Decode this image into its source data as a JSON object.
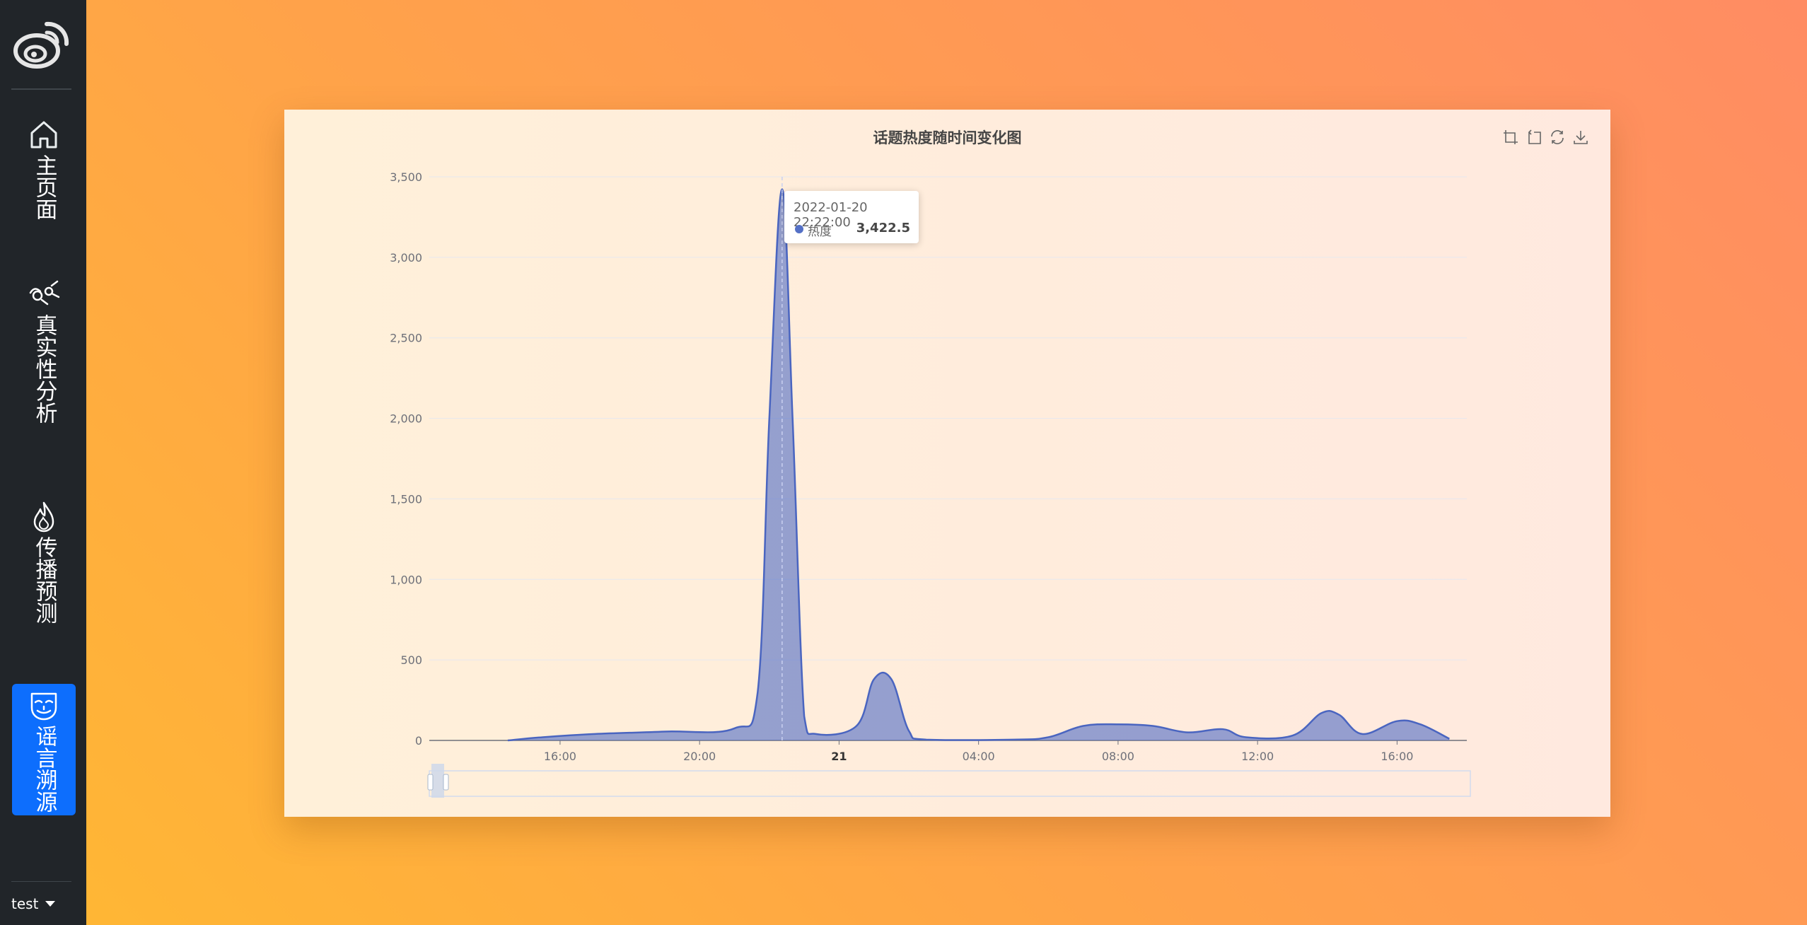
{
  "sidebar": {
    "items": [
      {
        "label": "主页面",
        "icon": "home-icon",
        "active": false
      },
      {
        "label": "真实性分析",
        "icon": "analysis-icon",
        "active": false
      },
      {
        "label": "传播预测",
        "icon": "flame-icon",
        "active": false
      },
      {
        "label": "谣言溯源",
        "icon": "mask-icon",
        "active": true
      }
    ],
    "user": "test"
  },
  "chart_data": {
    "type": "area",
    "title": "话题热度随时间变化图",
    "series": [
      {
        "name": "热度",
        "color": "#5470c6",
        "points": [
          [
            "2022-01-20 14:30",
            0
          ],
          [
            "2022-01-20 15:30",
            20
          ],
          [
            "2022-01-20 17:00",
            40
          ],
          [
            "2022-01-20 19:00",
            55
          ],
          [
            "2022-01-20 21:00",
            75
          ],
          [
            "2022-01-20 21:40",
            300
          ],
          [
            "2022-01-20 22:00",
            2000
          ],
          [
            "2022-01-20 22:22",
            3422.5
          ],
          [
            "2022-01-20 22:40",
            2000
          ],
          [
            "2022-01-20 23:00",
            150
          ],
          [
            "2022-01-20 23:20",
            40
          ],
          [
            "2022-01-21 00:30",
            90
          ],
          [
            "2022-01-21 01:00",
            380
          ],
          [
            "2022-01-21 01:30",
            380
          ],
          [
            "2022-01-21 02:00",
            60
          ],
          [
            "2022-01-21 02:30",
            5
          ],
          [
            "2022-01-21 05:00",
            5
          ],
          [
            "2022-01-21 06:00",
            20
          ],
          [
            "2022-01-21 07:00",
            90
          ],
          [
            "2022-01-21 08:00",
            100
          ],
          [
            "2022-01-21 09:00",
            90
          ],
          [
            "2022-01-21 10:00",
            50
          ],
          [
            "2022-01-21 11:00",
            70
          ],
          [
            "2022-01-21 11:40",
            20
          ],
          [
            "2022-01-21 13:00",
            30
          ],
          [
            "2022-01-21 13:50",
            170
          ],
          [
            "2022-01-21 14:20",
            160
          ],
          [
            "2022-01-21 15:00",
            40
          ],
          [
            "2022-01-21 16:00",
            120
          ],
          [
            "2022-01-21 16:40",
            100
          ],
          [
            "2022-01-21 17:30",
            10
          ]
        ]
      }
    ],
    "y_ticks": [
      "0",
      "500",
      "1,000",
      "1,500",
      "2,000",
      "2,500",
      "3,000",
      "3,500"
    ],
    "ylim": [
      0,
      3500
    ],
    "x_ticks": [
      "16:00",
      "20:00",
      "21",
      "04:00",
      "08:00",
      "12:00",
      "16:00"
    ],
    "xlim": [
      "2022-01-20 12:15",
      "2022-01-21 18:00"
    ],
    "grid": true,
    "tooltip": {
      "time": "2022-01-20 22:22:00",
      "series": "热度",
      "value": "3,422.5"
    }
  }
}
